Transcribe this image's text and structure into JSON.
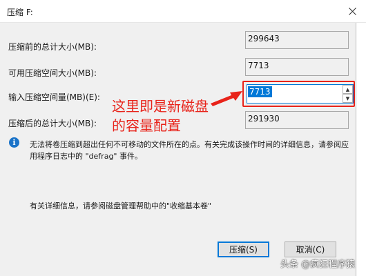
{
  "window": {
    "title": "压缩 F:",
    "close_glyph": "✕"
  },
  "fields": {
    "total_before_label": "压缩前的总计大小(MB):",
    "total_before_value": "299643",
    "available_label": "可用压缩空间大小(MB):",
    "available_value": "7713",
    "input_label": "输入压缩空间量(MB)(E):",
    "input_value": "7713",
    "total_after_label": "压缩后的总计大小(MB):",
    "total_after_value": "291930"
  },
  "annotation": {
    "line1": "这里即是新磁盘",
    "line2": "的容量配置",
    "color": "#e8231a"
  },
  "info": {
    "icon": "info-icon",
    "text": "无法将卷压缩到超出任何不可移动的文件所在的点。有关完成该操作时间的详细信息，请参阅应用程序日志中的 \"defrag\" 事件。"
  },
  "detail": {
    "text": "有关详细信息，请参阅磁盘管理帮助中的\"收缩基本卷\""
  },
  "buttons": {
    "shrink": "压缩(S)",
    "cancel": "取消(C)"
  },
  "watermark": {
    "text": "头条 @疯狂程序猿"
  },
  "colors": {
    "accent": "#0078d7",
    "annotation_red": "#e8231a",
    "info_blue": "#1a73c8"
  }
}
